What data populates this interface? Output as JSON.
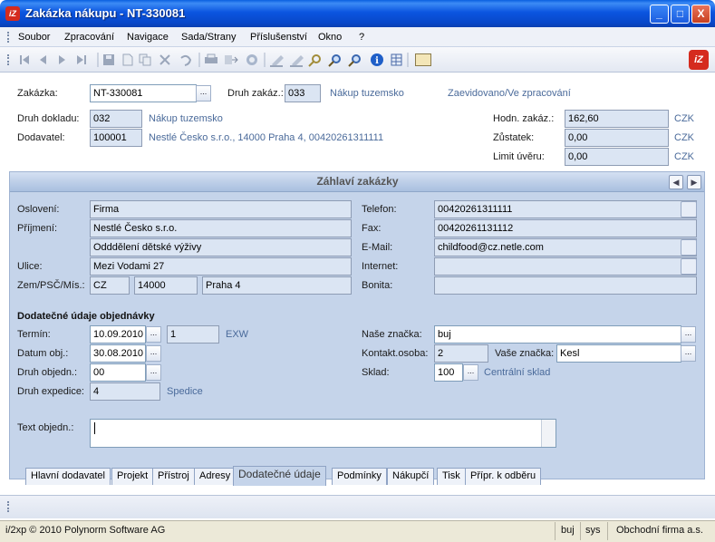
{
  "window": {
    "title": "Zakázka nákupu - NT-330081",
    "app_icon": "iz-app-icon",
    "controls": {
      "minimize": "_",
      "maximize": "□",
      "close": "X"
    }
  },
  "menu": {
    "items": [
      "Soubor",
      "Zpracování",
      "Navigace",
      "Sada/Strany",
      "Příslušenství",
      "Okno",
      "?"
    ]
  },
  "toolbar": {
    "icons": [
      "first-icon",
      "prev-icon",
      "next-icon",
      "last-icon",
      "save-icon",
      "new-icon",
      "copy-icon",
      "delete-icon",
      "undo-icon",
      "print-icon",
      "export-icon",
      "refresh-icon",
      "edit-icon",
      "edit2-icon",
      "search-icon",
      "zoom-icon",
      "find-icon",
      "info-icon",
      "table-icon",
      "card-icon"
    ]
  },
  "header": {
    "zakazka_label": "Zakázka:",
    "zakazka_value": "NT-330081",
    "druh_zakaz_label": "Druh zakáz.:",
    "druh_zakaz_code": "033",
    "druh_zakaz_text": "Nákup tuzemsko",
    "status_text": "Zaevidovano/Ve zpracování",
    "druh_dokladu_label": "Druh dokladu:",
    "druh_dokladu_code": "032",
    "druh_dokladu_text": "Nákup tuzemsko",
    "dodavatel_label": "Dodavatel:",
    "dodavatel_code": "100001",
    "dodavatel_text": "Nestlé Česko s.r.o., 14000 Praha 4, 00420261311111",
    "hodn_label": "Hodn. zakáz.:",
    "hodn_value": "162,60",
    "hodn_cur": "CZK",
    "zustatek_label": "Zůstatek:",
    "zustatek_value": "0,00",
    "zustatek_cur": "CZK",
    "limit_label": "Limit úvěru:",
    "limit_value": "0,00",
    "limit_cur": "CZK"
  },
  "section": {
    "title": "Záhlaví zakázky",
    "osloveni_label": "Oslovení:",
    "osloveni_value": "Firma",
    "prijmeni_label": "Příjmení:",
    "prijmeni_value": "Nestlé Česko s.r.o.",
    "prijmeni2_value": "Odddělení dětské výživy",
    "ulice_label": "Ulice:",
    "ulice_value": "Mezi Vodami 27",
    "zem_label": "Zem/PSČ/Mís.:",
    "zem_value": "CZ",
    "psc_value": "14000",
    "misto_value": "Praha 4",
    "telefon_label": "Telefon:",
    "telefon_value": "00420261311111",
    "fax_label": "Fax:",
    "fax_value": "00420261131112",
    "email_label": "E-Mail:",
    "email_value": "childfood@cz.netle.com",
    "internet_label": "Internet:",
    "internet_value": "",
    "bonita_label": "Bonita:",
    "bonita_value": ""
  },
  "extra": {
    "heading": "Dodatečné údaje objednávky",
    "termin_label": "Termín:",
    "termin_value": "10.09.2010",
    "termin_num": "1",
    "termin_incoterm": "EXW",
    "datum_label": "Datum obj.:",
    "datum_value": "30.08.2010",
    "druh_obj_label": "Druh objedn.:",
    "druh_obj_value": "00",
    "druh_exp_label": "Druh expedice:",
    "druh_exp_value": "4",
    "druh_exp_text": "Spedice",
    "nase_label": "Naše značka:",
    "nase_value": "buj",
    "kontakt_label": "Kontakt.osoba:",
    "kontakt_value": "2",
    "vase_label": "Vaše značka:",
    "vase_value": "Kesl",
    "sklad_label": "Sklad:",
    "sklad_value": "100",
    "sklad_text": "Centrální sklad",
    "text_label": "Text objedn.:",
    "text_value": "",
    "more_btn": "..."
  },
  "tabs": [
    "Hlavní dodavatel",
    "Projekt",
    "Přístroj",
    "Adresy",
    "Dodatečné údaje",
    "Podmínky",
    "Nákupčí",
    "Tisk",
    "Přípr. k odběru"
  ],
  "status": {
    "copyright": "i/2xp © 2010 Polynorm Software AG",
    "user": "buj",
    "db": "sys",
    "company": "Obchodní firma a.s."
  }
}
